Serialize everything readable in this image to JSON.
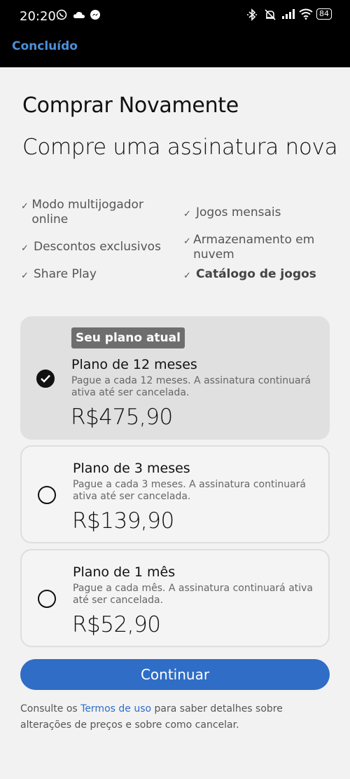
{
  "status_bar": {
    "time": "20:20",
    "left_icons": [
      "whatsapp-icon",
      "cloud-icon",
      "messenger-icon"
    ],
    "right_icons": [
      "bluetooth-icon",
      "mute-icon",
      "signal-icon",
      "wifi-icon"
    ],
    "battery": "84"
  },
  "header": {
    "done_label": "Concluído"
  },
  "page": {
    "title": "Comprar Novamente",
    "subtitle": "Compre uma assinatura nova"
  },
  "features": [
    {
      "label": "Modo multijogador online",
      "bold": false
    },
    {
      "label": "Jogos mensais",
      "bold": false
    },
    {
      "label": "Descontos exclusivos",
      "bold": false
    },
    {
      "label": "Armazenamento em nuvem",
      "bold": false
    },
    {
      "label": "Share Play",
      "bold": false
    },
    {
      "label": "Catálogo de jogos",
      "bold": true
    }
  ],
  "plans": [
    {
      "badge": "Seu plano atual",
      "name": "Plano de 12 meses",
      "description": "Pague a cada 12 meses. A assinatura continuará ativa até ser cancelada.",
      "price": "R$475,90",
      "selected": true
    },
    {
      "name": "Plano de 3 meses",
      "description": "Pague a cada 3 meses. A assinatura continuará ativa até ser cancelada.",
      "price": "R$139,90",
      "selected": false
    },
    {
      "name": "Plano de 1 mês",
      "description": "Pague a cada mês. A assinatura continuará ativa até ser cancelada.",
      "price": "R$52,90",
      "selected": false
    }
  ],
  "continue_label": "Continuar",
  "footer": {
    "prefix": "Consulte os ",
    "link": "Termos de uso",
    "suffix": " para saber detalhes sobre alterações de preços e sobre como cancelar."
  },
  "colors": {
    "accent": "#2f6dc6",
    "done_link": "#4c8fd8",
    "selected_card": "#e0e0e0",
    "badge": "#6e6e6e"
  }
}
